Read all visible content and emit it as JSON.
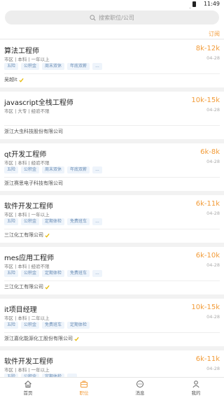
{
  "status": {
    "time": "11:49"
  },
  "search": {
    "placeholder": "搜索职位/公司"
  },
  "subscribe_label": "订阅",
  "jobs": [
    {
      "title": "算法工程师",
      "salary": "8k-12k",
      "meta": "市区 | 本科 | 一年以上",
      "date": "04-28",
      "tags": [
        "五险",
        "公积金",
        "周末双休",
        "年底双薪",
        "..."
      ],
      "company": "吴越it",
      "verified": true
    },
    {
      "title": "javascript全栈工程师",
      "salary": "10k-15k",
      "meta": "市区 | 大专 | 经验不限",
      "date": "04-28",
      "tags": [],
      "company": "浙江大虫科技股份有限公司",
      "verified": false
    },
    {
      "title": "qt开发工程师",
      "salary": "6k-8k",
      "meta": "市区 | 本科 | 经验不限",
      "date": "04-28",
      "tags": [
        "五险",
        "公积金",
        "周末双休",
        "年底双薪",
        "..."
      ],
      "company": "浙江赛思电子科技有限公司",
      "verified": false
    },
    {
      "title": "软件开发工程师",
      "salary": "6k-11k",
      "meta": "市区 | 本科 | 一年以上",
      "date": "04-28",
      "tags": [
        "五险",
        "公积金",
        "定期体检",
        "免费班车",
        "..."
      ],
      "company": "三江化工有限公司",
      "verified": true
    },
    {
      "title": "mes应用工程师",
      "salary": "6k-10k",
      "meta": "市区 | 本科 | 经验不限",
      "date": "04-28",
      "tags": [
        "五险",
        "公积金",
        "定期体检",
        "免费班车",
        "..."
      ],
      "company": "三江化工有限公司",
      "verified": true
    },
    {
      "title": "it项目经理",
      "salary": "10k-15k",
      "meta": "市区 | 本科 | 二年以上",
      "date": "04-28",
      "tags": [
        "五险",
        "公积金",
        "免费班车",
        "定期体检"
      ],
      "company": "浙江嘉化能源化工股份有限公司",
      "verified": true
    },
    {
      "title": "软件开发工程师",
      "salary": "6k-11k",
      "meta": "市区 | 本科 | 一年以上",
      "date": "04-28",
      "tags": [
        "五险",
        "公积金",
        "定期体检",
        "..."
      ],
      "company": "",
      "verified": false
    }
  ],
  "tabs": [
    {
      "label": "首页",
      "icon": "home-icon"
    },
    {
      "label": "职位",
      "icon": "briefcase-icon",
      "active": true
    },
    {
      "label": "消息",
      "icon": "message-icon"
    },
    {
      "label": "我的",
      "icon": "user-icon"
    }
  ],
  "colors": {
    "accent": "#f29b38",
    "tag_text": "#6a8db5",
    "tag_bg": "#eef4fb"
  }
}
